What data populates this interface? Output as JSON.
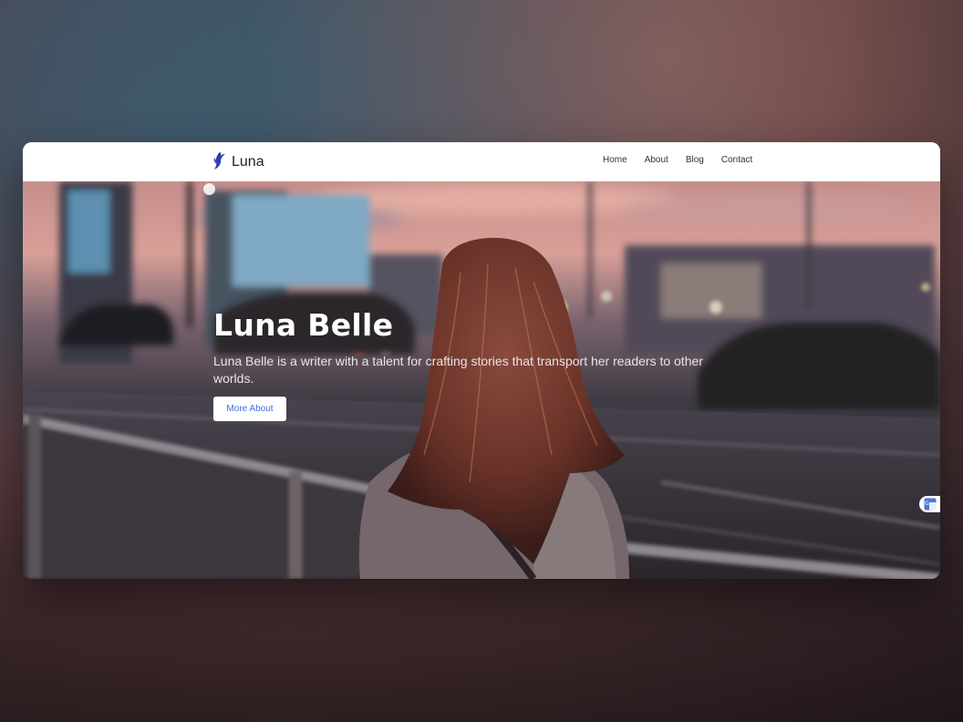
{
  "brand": {
    "name": "Luna",
    "logo_icon": "bird-logo-icon"
  },
  "nav": {
    "items": [
      {
        "label": "Home"
      },
      {
        "label": "About"
      },
      {
        "label": "Blog"
      },
      {
        "label": "Contact"
      }
    ]
  },
  "hero": {
    "title": "Luna Belle",
    "description": "Luna Belle is a writer with a talent for crafting stories that transport her readers to other worlds.",
    "button_label": "More About",
    "button_text_color": "#3a6fd8"
  },
  "widgets": {
    "translate_icon": "google-translate-icon"
  }
}
